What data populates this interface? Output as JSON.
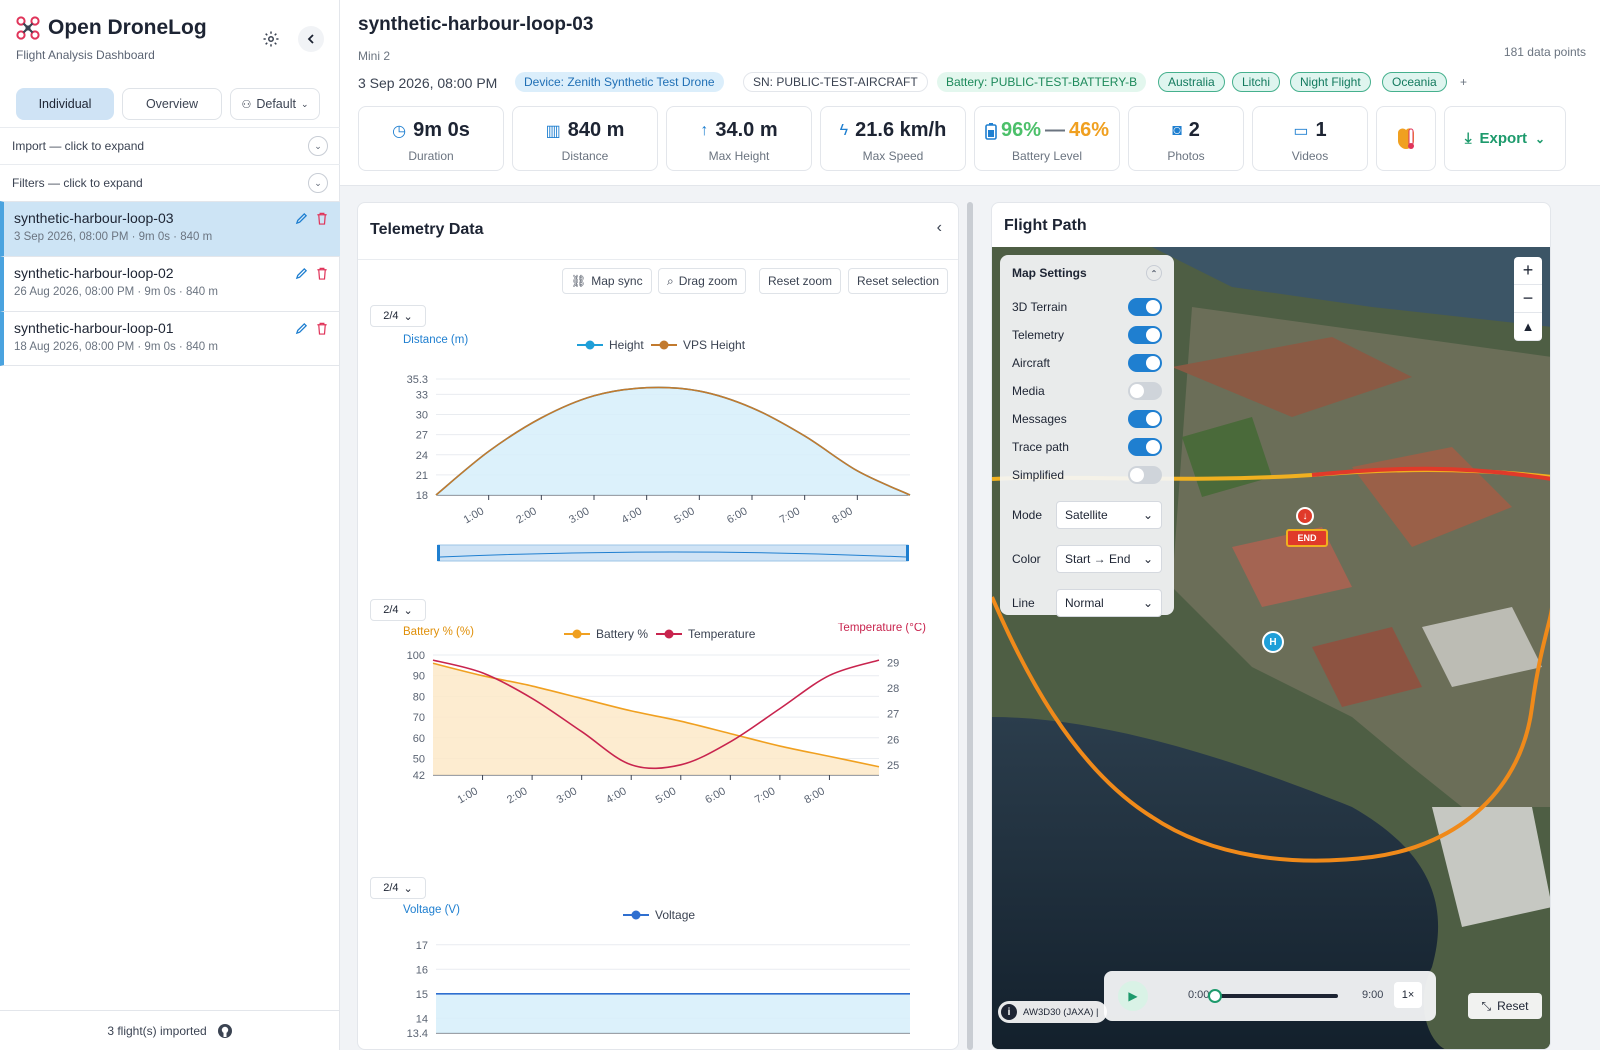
{
  "app": {
    "title": "Open DroneLog",
    "subtitle": "Flight Analysis Dashboard"
  },
  "sidebar": {
    "tabs": [
      {
        "label": "Individual",
        "active": true
      },
      {
        "label": "Overview",
        "active": false
      }
    ],
    "profile_label": "Default",
    "import_label": "Import — click to expand",
    "filters_label": "Filters — click to expand",
    "flights": [
      {
        "name": "synthetic-harbour-loop-03",
        "meta": "3 Sep 2026, 08:00 PM · 9m 0s · 840 m",
        "selected": true
      },
      {
        "name": "synthetic-harbour-loop-02",
        "meta": "26 Aug 2026, 08:00 PM · 9m 0s · 840 m",
        "selected": false
      },
      {
        "name": "synthetic-harbour-loop-01",
        "meta": "18 Aug 2026, 08:00 PM · 9m 0s · 840 m",
        "selected": false
      }
    ],
    "footer_label": "3 flight(s) imported"
  },
  "header": {
    "title": "synthetic-harbour-loop-03",
    "model": "Mini 2",
    "data_points": "181 data points",
    "date": "3 Sep 2026, 08:00 PM",
    "chips": {
      "device": "Device: Zenith Synthetic Test Drone",
      "serial": "SN: PUBLIC-TEST-AIRCRAFT",
      "battery": "Battery: PUBLIC-TEST-BATTERY-B",
      "tag1": "Australia",
      "tag2": "Litchi",
      "tag3": "Night Flight",
      "tag4": "Oceania",
      "add": "+"
    },
    "stats": {
      "duration": {
        "value": "9m 0s",
        "label": "Duration"
      },
      "distance": {
        "value": "840 m",
        "label": "Distance"
      },
      "max_height": {
        "value": "34.0 m",
        "label": "Max Height"
      },
      "max_speed": {
        "value": "21.6 km/h",
        "label": "Max Speed"
      },
      "battery": {
        "start": "96%",
        "sep": "—",
        "end": "46%",
        "label": "Battery Level"
      },
      "photos": {
        "value": "2",
        "label": "Photos"
      },
      "videos": {
        "value": "1",
        "label": "Videos"
      }
    },
    "export_label": "Export"
  },
  "telemetry": {
    "title": "Telemetry Data",
    "toolbar": {
      "map_sync": "Map sync",
      "drag_zoom": "Drag zoom",
      "reset_zoom": "Reset zoom",
      "reset_selection": "Reset selection"
    },
    "pager_label": "2/4"
  },
  "chart_data": [
    {
      "type": "line",
      "ylabel": "Distance (m)",
      "legend": [
        "Height",
        "VPS Height"
      ],
      "x_ticks": [
        "1:00",
        "2:00",
        "3:00",
        "4:00",
        "5:00",
        "6:00",
        "7:00",
        "8:00"
      ],
      "y_ticks": [
        "35.3",
        "33",
        "30",
        "27",
        "24",
        "21",
        "18"
      ],
      "ylim": [
        18,
        35.3
      ],
      "x": [
        0,
        60,
        120,
        180,
        240,
        300,
        360,
        420,
        480,
        540
      ],
      "series": [
        {
          "name": "Height",
          "color": "#1f9fd8",
          "values": [
            18,
            24.5,
            29.5,
            32.8,
            34.0,
            33.5,
            31.0,
            26.8,
            21.6,
            18
          ]
        },
        {
          "name": "VPS Height",
          "color": "#c27a2e",
          "values": [
            18,
            24.5,
            29.5,
            32.8,
            34.0,
            33.5,
            31.0,
            26.8,
            21.6,
            18
          ]
        }
      ]
    },
    {
      "type": "line",
      "ylabel": "Battery % (%)",
      "y2label": "Temperature (°C)",
      "legend": [
        "Battery %",
        "Temperature"
      ],
      "x_ticks": [
        "1:00",
        "2:00",
        "3:00",
        "4:00",
        "5:00",
        "6:00",
        "7:00",
        "8:00"
      ],
      "y_ticks": [
        "100",
        "90",
        "80",
        "70",
        "60",
        "50",
        "42"
      ],
      "y2_ticks": [
        "29",
        "28",
        "27",
        "26",
        "25"
      ],
      "ylim": [
        42,
        100
      ],
      "y2lim": [
        24.6,
        29.3
      ],
      "x": [
        0,
        60,
        120,
        180,
        240,
        300,
        360,
        420,
        480,
        540
      ],
      "series": [
        {
          "name": "Battery %",
          "color": "#f0a020",
          "axis": "left",
          "values": [
            96,
            90,
            85,
            79,
            73,
            68,
            62,
            56,
            51,
            46
          ]
        },
        {
          "name": "Temperature",
          "color": "#c8244e",
          "axis": "right",
          "values": [
            29.1,
            28.6,
            27.6,
            26.3,
            25.0,
            25.0,
            25.9,
            27.2,
            28.5,
            29.1
          ]
        }
      ]
    },
    {
      "type": "line",
      "ylabel": "Voltage (V)",
      "legend": [
        "Voltage"
      ],
      "y_ticks": [
        "17",
        "16",
        "15",
        "14",
        "13.4"
      ],
      "ylim": [
        13.4,
        17.4
      ],
      "x": [
        0,
        540
      ],
      "series": [
        {
          "name": "Voltage",
          "color": "#2f6fd0",
          "values": [
            15.0,
            15.0
          ]
        }
      ]
    }
  ],
  "map": {
    "title": "Flight Path",
    "settings_title": "Map Settings",
    "toggles": [
      {
        "label": "3D Terrain",
        "on": true
      },
      {
        "label": "Telemetry",
        "on": true
      },
      {
        "label": "Aircraft",
        "on": true
      },
      {
        "label": "Media",
        "on": false
      },
      {
        "label": "Messages",
        "on": true
      },
      {
        "label": "Trace path",
        "on": true
      },
      {
        "label": "Simplified",
        "on": false
      }
    ],
    "selects": {
      "mode_label": "Mode",
      "mode_value": "Satellite",
      "color_label": "Color",
      "color_value": "Start → End",
      "line_label": "Line",
      "line_value": "Normal"
    },
    "end_marker": "END",
    "home_marker": "H",
    "player": {
      "start": "0:00",
      "end": "9:00",
      "speed": "1×"
    },
    "attribution": "AW3D30 (JAXA) |",
    "reset_label": "Reset"
  }
}
